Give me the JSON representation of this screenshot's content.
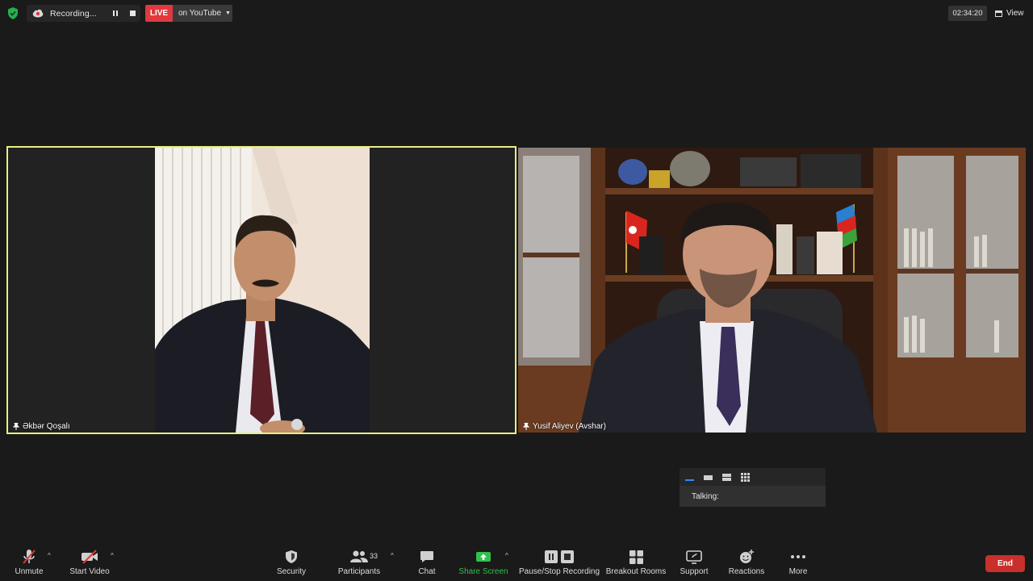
{
  "top_bar": {
    "recording_label": "Recording...",
    "live_badge": "LIVE",
    "live_destination": "on YouTube",
    "meeting_time": "02:34:20",
    "view_label": "View"
  },
  "participants": [
    {
      "name": "Əkbər Qoşalı",
      "active_speaker": true
    },
    {
      "name": "Yusif Aliyev (Avshar)",
      "active_speaker": false
    }
  ],
  "talking_panel": {
    "label": "Talking:"
  },
  "toolbar": {
    "unmute": "Unmute",
    "start_video": "Start Video",
    "security": "Security",
    "participants": "Participants",
    "participants_count": "33",
    "chat": "Chat",
    "share_screen": "Share Screen",
    "pause_stop_recording": "Pause/Stop Recording",
    "breakout_rooms": "Breakout Rooms",
    "support": "Support",
    "reactions": "Reactions",
    "more": "More",
    "end": "End"
  },
  "colors": {
    "background": "#1a1a1a",
    "active_speaker_border": "#e9ef83",
    "live_red": "#e0393e",
    "share_green": "#2fc24a",
    "end_red": "#c9302c",
    "muted_red": "#e0393e"
  }
}
